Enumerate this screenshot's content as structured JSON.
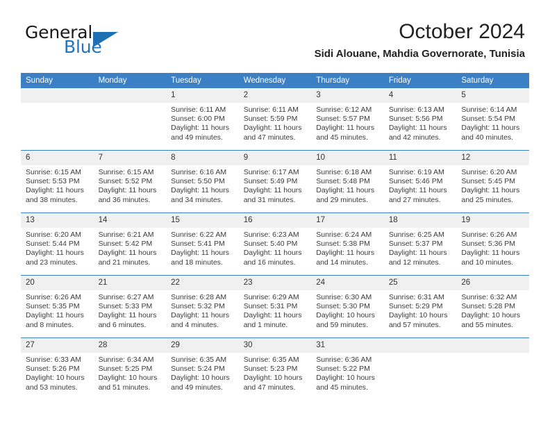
{
  "brand": {
    "name_part1": "General",
    "name_part2": "Blue",
    "accent_color": "#1f74bd",
    "flag_icon": "triangle-flag-icon"
  },
  "header": {
    "month_title": "October 2024",
    "location": "Sidi Alouane, Mahdia Governorate, Tunisia"
  },
  "calendar": {
    "header_background": "#3b7fc4",
    "daynum_background": "#f0f0f0",
    "weekday_labels": [
      "Sunday",
      "Monday",
      "Tuesday",
      "Wednesday",
      "Thursday",
      "Friday",
      "Saturday"
    ],
    "weeks": [
      [
        {
          "day": "",
          "sunrise": "",
          "sunset": "",
          "daylight1": "",
          "daylight2": ""
        },
        {
          "day": "",
          "sunrise": "",
          "sunset": "",
          "daylight1": "",
          "daylight2": ""
        },
        {
          "day": "1",
          "sunrise": "Sunrise: 6:11 AM",
          "sunset": "Sunset: 6:00 PM",
          "daylight1": "Daylight: 11 hours",
          "daylight2": "and 49 minutes."
        },
        {
          "day": "2",
          "sunrise": "Sunrise: 6:11 AM",
          "sunset": "Sunset: 5:59 PM",
          "daylight1": "Daylight: 11 hours",
          "daylight2": "and 47 minutes."
        },
        {
          "day": "3",
          "sunrise": "Sunrise: 6:12 AM",
          "sunset": "Sunset: 5:57 PM",
          "daylight1": "Daylight: 11 hours",
          "daylight2": "and 45 minutes."
        },
        {
          "day": "4",
          "sunrise": "Sunrise: 6:13 AM",
          "sunset": "Sunset: 5:56 PM",
          "daylight1": "Daylight: 11 hours",
          "daylight2": "and 42 minutes."
        },
        {
          "day": "5",
          "sunrise": "Sunrise: 6:14 AM",
          "sunset": "Sunset: 5:54 PM",
          "daylight1": "Daylight: 11 hours",
          "daylight2": "and 40 minutes."
        }
      ],
      [
        {
          "day": "6",
          "sunrise": "Sunrise: 6:15 AM",
          "sunset": "Sunset: 5:53 PM",
          "daylight1": "Daylight: 11 hours",
          "daylight2": "and 38 minutes."
        },
        {
          "day": "7",
          "sunrise": "Sunrise: 6:15 AM",
          "sunset": "Sunset: 5:52 PM",
          "daylight1": "Daylight: 11 hours",
          "daylight2": "and 36 minutes."
        },
        {
          "day": "8",
          "sunrise": "Sunrise: 6:16 AM",
          "sunset": "Sunset: 5:50 PM",
          "daylight1": "Daylight: 11 hours",
          "daylight2": "and 34 minutes."
        },
        {
          "day": "9",
          "sunrise": "Sunrise: 6:17 AM",
          "sunset": "Sunset: 5:49 PM",
          "daylight1": "Daylight: 11 hours",
          "daylight2": "and 31 minutes."
        },
        {
          "day": "10",
          "sunrise": "Sunrise: 6:18 AM",
          "sunset": "Sunset: 5:48 PM",
          "daylight1": "Daylight: 11 hours",
          "daylight2": "and 29 minutes."
        },
        {
          "day": "11",
          "sunrise": "Sunrise: 6:19 AM",
          "sunset": "Sunset: 5:46 PM",
          "daylight1": "Daylight: 11 hours",
          "daylight2": "and 27 minutes."
        },
        {
          "day": "12",
          "sunrise": "Sunrise: 6:20 AM",
          "sunset": "Sunset: 5:45 PM",
          "daylight1": "Daylight: 11 hours",
          "daylight2": "and 25 minutes."
        }
      ],
      [
        {
          "day": "13",
          "sunrise": "Sunrise: 6:20 AM",
          "sunset": "Sunset: 5:44 PM",
          "daylight1": "Daylight: 11 hours",
          "daylight2": "and 23 minutes."
        },
        {
          "day": "14",
          "sunrise": "Sunrise: 6:21 AM",
          "sunset": "Sunset: 5:42 PM",
          "daylight1": "Daylight: 11 hours",
          "daylight2": "and 21 minutes."
        },
        {
          "day": "15",
          "sunrise": "Sunrise: 6:22 AM",
          "sunset": "Sunset: 5:41 PM",
          "daylight1": "Daylight: 11 hours",
          "daylight2": "and 18 minutes."
        },
        {
          "day": "16",
          "sunrise": "Sunrise: 6:23 AM",
          "sunset": "Sunset: 5:40 PM",
          "daylight1": "Daylight: 11 hours",
          "daylight2": "and 16 minutes."
        },
        {
          "day": "17",
          "sunrise": "Sunrise: 6:24 AM",
          "sunset": "Sunset: 5:38 PM",
          "daylight1": "Daylight: 11 hours",
          "daylight2": "and 14 minutes."
        },
        {
          "day": "18",
          "sunrise": "Sunrise: 6:25 AM",
          "sunset": "Sunset: 5:37 PM",
          "daylight1": "Daylight: 11 hours",
          "daylight2": "and 12 minutes."
        },
        {
          "day": "19",
          "sunrise": "Sunrise: 6:26 AM",
          "sunset": "Sunset: 5:36 PM",
          "daylight1": "Daylight: 11 hours",
          "daylight2": "and 10 minutes."
        }
      ],
      [
        {
          "day": "20",
          "sunrise": "Sunrise: 6:26 AM",
          "sunset": "Sunset: 5:35 PM",
          "daylight1": "Daylight: 11 hours",
          "daylight2": "and 8 minutes."
        },
        {
          "day": "21",
          "sunrise": "Sunrise: 6:27 AM",
          "sunset": "Sunset: 5:33 PM",
          "daylight1": "Daylight: 11 hours",
          "daylight2": "and 6 minutes."
        },
        {
          "day": "22",
          "sunrise": "Sunrise: 6:28 AM",
          "sunset": "Sunset: 5:32 PM",
          "daylight1": "Daylight: 11 hours",
          "daylight2": "and 4 minutes."
        },
        {
          "day": "23",
          "sunrise": "Sunrise: 6:29 AM",
          "sunset": "Sunset: 5:31 PM",
          "daylight1": "Daylight: 11 hours",
          "daylight2": "and 1 minute."
        },
        {
          "day": "24",
          "sunrise": "Sunrise: 6:30 AM",
          "sunset": "Sunset: 5:30 PM",
          "daylight1": "Daylight: 10 hours",
          "daylight2": "and 59 minutes."
        },
        {
          "day": "25",
          "sunrise": "Sunrise: 6:31 AM",
          "sunset": "Sunset: 5:29 PM",
          "daylight1": "Daylight: 10 hours",
          "daylight2": "and 57 minutes."
        },
        {
          "day": "26",
          "sunrise": "Sunrise: 6:32 AM",
          "sunset": "Sunset: 5:28 PM",
          "daylight1": "Daylight: 10 hours",
          "daylight2": "and 55 minutes."
        }
      ],
      [
        {
          "day": "27",
          "sunrise": "Sunrise: 6:33 AM",
          "sunset": "Sunset: 5:26 PM",
          "daylight1": "Daylight: 10 hours",
          "daylight2": "and 53 minutes."
        },
        {
          "day": "28",
          "sunrise": "Sunrise: 6:34 AM",
          "sunset": "Sunset: 5:25 PM",
          "daylight1": "Daylight: 10 hours",
          "daylight2": "and 51 minutes."
        },
        {
          "day": "29",
          "sunrise": "Sunrise: 6:35 AM",
          "sunset": "Sunset: 5:24 PM",
          "daylight1": "Daylight: 10 hours",
          "daylight2": "and 49 minutes."
        },
        {
          "day": "30",
          "sunrise": "Sunrise: 6:35 AM",
          "sunset": "Sunset: 5:23 PM",
          "daylight1": "Daylight: 10 hours",
          "daylight2": "and 47 minutes."
        },
        {
          "day": "31",
          "sunrise": "Sunrise: 6:36 AM",
          "sunset": "Sunset: 5:22 PM",
          "daylight1": "Daylight: 10 hours",
          "daylight2": "and 45 minutes."
        },
        {
          "day": "",
          "sunrise": "",
          "sunset": "",
          "daylight1": "",
          "daylight2": ""
        },
        {
          "day": "",
          "sunrise": "",
          "sunset": "",
          "daylight1": "",
          "daylight2": ""
        }
      ]
    ]
  }
}
